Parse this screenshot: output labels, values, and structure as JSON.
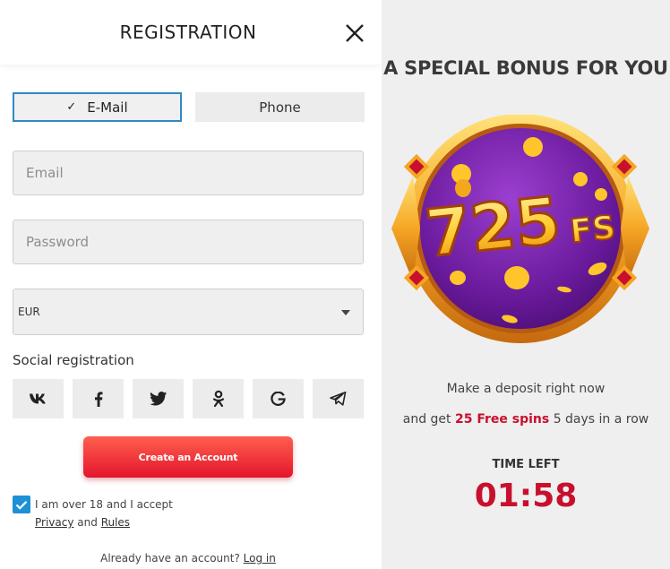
{
  "header": {
    "title": "REGISTRATION",
    "close_icon": "close-icon"
  },
  "tabs": {
    "email_label": "E-Mail",
    "phone_label": "Phone",
    "active": "E-Mail"
  },
  "form": {
    "email_placeholder": "Email",
    "password_placeholder": "Password",
    "currency_value": "EUR"
  },
  "social": {
    "label": "Social registration",
    "providers": [
      "vk-icon",
      "facebook-icon",
      "twitter-icon",
      "odnoklassniki-icon",
      "google-icon",
      "telegram-icon"
    ]
  },
  "cta": {
    "label": "Create an Account"
  },
  "consent": {
    "checked": true,
    "text": "I am over 18 and I accept",
    "privacy": "Privacy",
    "and": "and",
    "rules": "Rules"
  },
  "login": {
    "prompt": "Already have an account?",
    "link": "Log in"
  },
  "bonus": {
    "title": "A SPECIAL BONUS FOR YOU",
    "badge_number": "725",
    "badge_suffix": "FS",
    "line1": "Make a deposit right now",
    "line2_pre": "and get",
    "line2_highlight": "25 Free spins",
    "line2_post": "5 days in a row",
    "timer_label": "TIME LEFT",
    "timer": "01:58"
  },
  "colors": {
    "accent": "#c8102e",
    "cta_top": "#ff5f4d",
    "cta_bottom": "#e3152d",
    "checkbox": "#1e90d6",
    "tab_border": "#2f8ac4"
  }
}
